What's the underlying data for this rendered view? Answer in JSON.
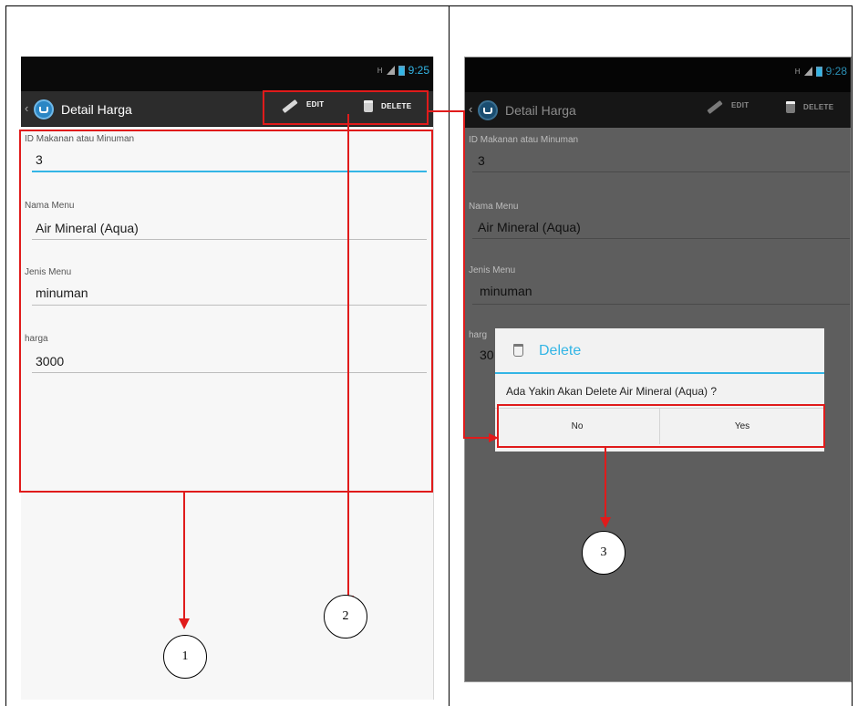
{
  "phone_left": {
    "status": {
      "time": "9:25",
      "signal": "H"
    },
    "actionbar": {
      "back_glyph": "‹",
      "title": "Detail Harga",
      "edit_label": "EDIT",
      "delete_label": "DELETE"
    },
    "fields": [
      {
        "label": "ID Makanan atau Minuman",
        "value": "3"
      },
      {
        "label": "Nama Menu",
        "value": "Air Mineral (Aqua)"
      },
      {
        "label": "Jenis Menu",
        "value": "minuman"
      },
      {
        "label": "harga",
        "value": "3000"
      }
    ]
  },
  "phone_right": {
    "status": {
      "time": "9:28",
      "signal": "H"
    },
    "actionbar": {
      "back_glyph": "‹",
      "title": "Detail Harga",
      "edit_label": "EDIT",
      "delete_label": "DELETE"
    },
    "fields": [
      {
        "label": "ID Makanan atau Minuman",
        "value": "3"
      },
      {
        "label": "Nama Menu",
        "value": "Air Mineral (Aqua)"
      },
      {
        "label": "Jenis Menu",
        "value": "minuman"
      },
      {
        "label": "harg",
        "value": "30"
      }
    ],
    "dialog": {
      "title": "Delete",
      "message": "Ada Yakin Akan Delete Air Mineral (Aqua) ?",
      "no_label": "No",
      "yes_label": "Yes"
    }
  },
  "callouts": {
    "one": "1",
    "two": "2",
    "three": "3"
  },
  "colors": {
    "accent": "#33b5e5",
    "annotation": "#e01b1b",
    "actionbar": "#2c2c2c"
  }
}
